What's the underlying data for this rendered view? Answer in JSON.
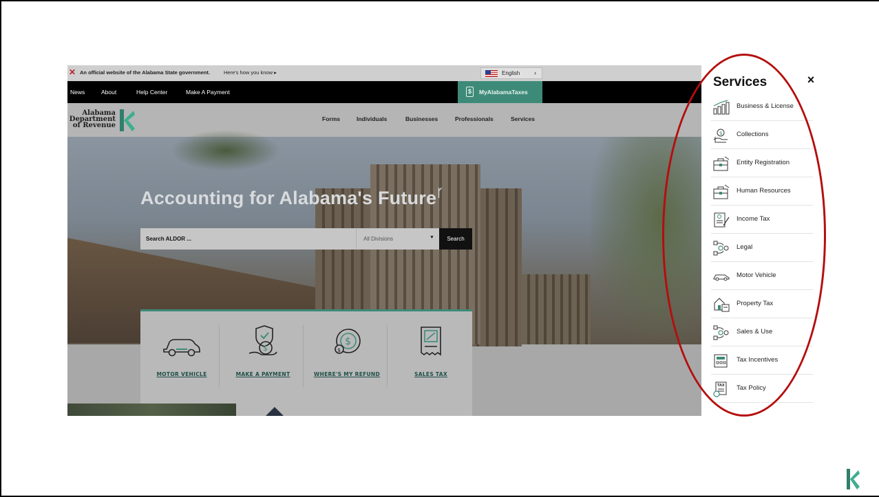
{
  "official_bar": {
    "text": "An official website of the Alabama State government.",
    "howto": "Here's how you know ▸",
    "language": "English",
    "language_arrow": "›"
  },
  "top_nav": {
    "items": [
      "News",
      "About",
      "Help Center",
      "Make A Payment"
    ],
    "my_taxes": "MyAlabamaTaxes"
  },
  "logo": {
    "line1": "Alabama",
    "line2": "Department",
    "line3": "of Revenue"
  },
  "main_nav": {
    "items": [
      "Forms",
      "Individuals",
      "Businesses",
      "Professionals",
      "Services"
    ]
  },
  "hero": {
    "title": "Accounting for Alabama's Future"
  },
  "search": {
    "placeholder": "Search ALDOR ...",
    "division": "All Divisions",
    "button": "Search"
  },
  "quick_links": [
    {
      "label": "MOTOR VEHICLE",
      "icon": "car-icon"
    },
    {
      "label": "MAKE A PAYMENT",
      "icon": "hand-money-icon"
    },
    {
      "label": "WHERE'S MY REFUND",
      "icon": "refund-coin-icon"
    },
    {
      "label": "SALES TAX",
      "icon": "receipt-icon"
    }
  ],
  "services_panel": {
    "title": "Services",
    "close": "×",
    "items": [
      {
        "label": "Business & License",
        "icon": "bar-chart-icon"
      },
      {
        "label": "Collections",
        "icon": "hand-coin-icon"
      },
      {
        "label": "Entity Registration",
        "icon": "briefcase-icon"
      },
      {
        "label": "Human Resources",
        "icon": "briefcase-icon"
      },
      {
        "label": "Income Tax",
        "icon": "document-pen-icon"
      },
      {
        "label": "Legal",
        "icon": "gavel-network-icon"
      },
      {
        "label": "Motor Vehicle",
        "icon": "car-icon"
      },
      {
        "label": "Property Tax",
        "icon": "house-document-icon"
      },
      {
        "label": "Sales & Use",
        "icon": "gear-network-icon"
      },
      {
        "label": "Tax Incentives",
        "icon": "calculator-document-icon"
      },
      {
        "label": "Tax Policy",
        "icon": "tax-document-icon"
      }
    ]
  },
  "colors": {
    "brand_green": "#3e8a79",
    "annotation_red": "#b50e0e"
  }
}
